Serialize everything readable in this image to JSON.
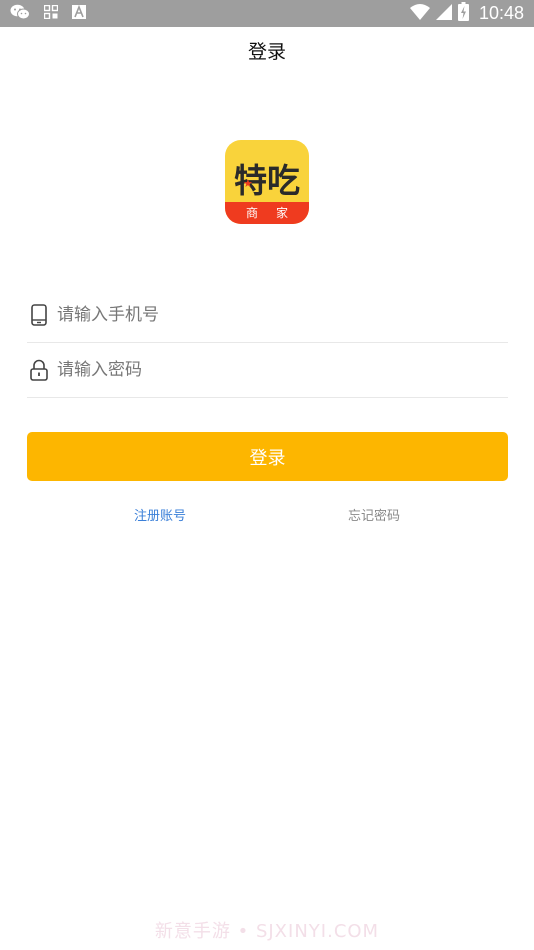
{
  "status_bar": {
    "time": "10:48",
    "left_icons": [
      "wechat-icon",
      "app-grid-icon",
      "text-a-icon"
    ],
    "right_icons": [
      "wifi-icon",
      "cell-signal-icon",
      "battery-charging-icon"
    ]
  },
  "header": {
    "title": "登录"
  },
  "logo": {
    "main_text": "特吃",
    "sub_text": "商家",
    "colors": {
      "background": "#f9d33b",
      "banner": "#ef3b1f"
    }
  },
  "form": {
    "phone": {
      "placeholder": "请输入手机号",
      "value": "",
      "icon": "phone-icon"
    },
    "password": {
      "placeholder": "请输入密码",
      "value": "",
      "icon": "lock-icon"
    },
    "login_label": "登录"
  },
  "links": {
    "register": "注册账号",
    "forgot": "忘记密码"
  },
  "watermark": "新意手游 • SJXINYI.COM",
  "colors": {
    "accent": "#fdb600",
    "link": "#3a7fd8"
  }
}
